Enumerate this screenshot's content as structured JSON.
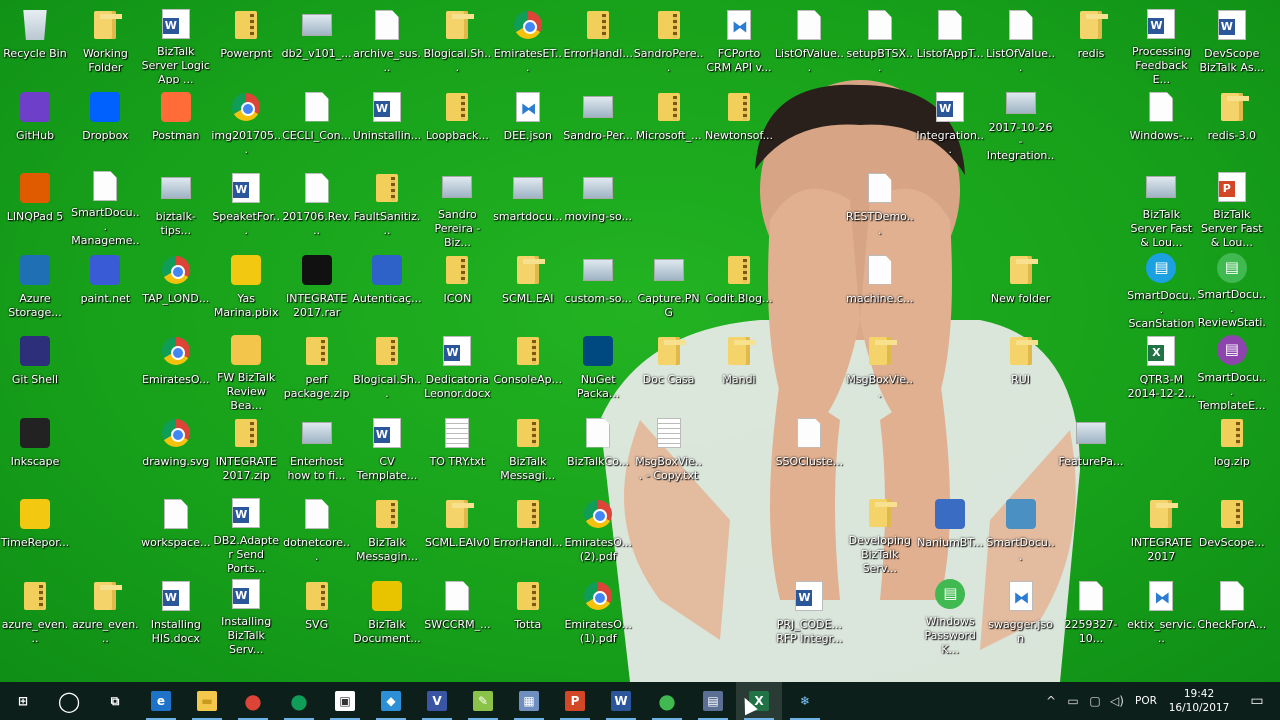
{
  "desktop": {
    "icons": [
      {
        "label": "Recycle Bin",
        "glyph": "recycle-bin-icon",
        "type": "recycle"
      },
      {
        "label": "Working Folder",
        "glyph": "folder-icon",
        "type": "folder"
      },
      {
        "label": "BizTalk Server Logic App ...",
        "glyph": "word-doc-icon",
        "type": "word"
      },
      {
        "label": "Powerpnt",
        "glyph": "powerpoint-shortcut-icon",
        "type": "zip"
      },
      {
        "label": "db2_v101_...",
        "glyph": "file-icon",
        "type": "img"
      },
      {
        "label": "archive_sus...",
        "glyph": "file-icon",
        "type": "file"
      },
      {
        "label": "Blogical.Sh...",
        "glyph": "folder-icon",
        "type": "folder"
      },
      {
        "label": "EmiratesET...",
        "glyph": "chrome-icon",
        "type": "chrome"
      },
      {
        "label": "ErrorHandl...",
        "glyph": "zip-icon",
        "type": "zip"
      },
      {
        "label": "SandroPere...",
        "glyph": "zip-icon",
        "type": "zip"
      },
      {
        "label": "FCPorto CRM API v...",
        "glyph": "vs-icon",
        "type": "vs"
      },
      {
        "label": "ListOfValue...",
        "glyph": "file-icon",
        "type": "file"
      },
      {
        "label": "setupBTSX...",
        "glyph": "file-icon",
        "type": "file"
      },
      {
        "label": "ListofAppT...",
        "glyph": "file-icon",
        "type": "file"
      },
      {
        "label": "ListOfValue...",
        "glyph": "file-icon",
        "type": "file"
      },
      {
        "label": "redis",
        "glyph": "folder-icon",
        "type": "folder"
      },
      {
        "label": "Processing Feedback E...",
        "glyph": "word-doc-icon",
        "type": "word"
      },
      {
        "label": "DevScope BizTalk As...",
        "glyph": "word-doc-icon",
        "type": "word"
      },
      {
        "label": "GitHub",
        "glyph": "github-icon",
        "type": "app",
        "color": "#6e40c9"
      },
      {
        "label": "Dropbox",
        "glyph": "dropbox-icon",
        "type": "app",
        "color": "#0061fe"
      },
      {
        "label": "Postman",
        "glyph": "postman-icon",
        "type": "app",
        "color": "#ff6c37"
      },
      {
        "label": "img201705...",
        "glyph": "chrome-icon",
        "type": "chrome"
      },
      {
        "label": "CECLI_Con...",
        "glyph": "file-icon",
        "type": "file"
      },
      {
        "label": "Uninstallin...",
        "glyph": "word-doc-icon",
        "type": "word"
      },
      {
        "label": "Loopback...",
        "glyph": "image-file-icon",
        "type": "zip"
      },
      {
        "label": "DEE.json",
        "glyph": "vs-icon",
        "type": "vs"
      },
      {
        "label": "Sandro-Per...",
        "glyph": "image-icon",
        "type": "img"
      },
      {
        "label": "Microsoft_...",
        "glyph": "zip-icon",
        "type": "zip"
      },
      {
        "label": "Newtonsof...",
        "glyph": "zip-icon",
        "type": "zip"
      },
      {
        "label": "Integration...",
        "glyph": "word-doc-icon",
        "type": "word"
      },
      {
        "label": "2017-10-26 - Integration...",
        "glyph": "image-icon",
        "type": "img"
      },
      {
        "label": "Windows-...",
        "glyph": "file-icon",
        "type": "file"
      },
      {
        "label": "redis-3.0",
        "glyph": "folder-icon",
        "type": "folder"
      },
      {
        "label": "LINQPad 5",
        "glyph": "linqpad-icon",
        "type": "app",
        "color": "#e05a00"
      },
      {
        "label": "SmartDocu... Manageme...",
        "glyph": "file-icon",
        "type": "file"
      },
      {
        "label": "biztalk-tips...",
        "glyph": "image-icon",
        "type": "img"
      },
      {
        "label": "SpeaketFor...",
        "glyph": "word-doc-icon",
        "type": "word"
      },
      {
        "label": "201706.Rev...",
        "glyph": "file-icon",
        "type": "file"
      },
      {
        "label": "FaultSanitiz...",
        "glyph": "zip-icon",
        "type": "zip"
      },
      {
        "label": "Sandro Pereira - Biz...",
        "glyph": "image-icon",
        "type": "img"
      },
      {
        "label": "smartdocu...",
        "glyph": "image-icon",
        "type": "img"
      },
      {
        "label": "moving-so...",
        "glyph": "image-icon",
        "type": "img"
      },
      {
        "label": "RESTDemo...",
        "glyph": "file-icon",
        "type": "file"
      },
      {
        "label": "BizTalk Server Fast & Lou...",
        "glyph": "image-icon",
        "type": "img"
      },
      {
        "label": "BizTalk Server Fast & Lou...",
        "glyph": "powerpoint-icon",
        "type": "ppt"
      },
      {
        "label": "Azure Storage...",
        "glyph": "azure-storage-icon",
        "type": "app",
        "color": "#1f6fb5"
      },
      {
        "label": "paint.net",
        "glyph": "paintnet-icon",
        "type": "app",
        "color": "#3a5bd6"
      },
      {
        "label": "TAP_LOND...",
        "glyph": "chrome-icon",
        "type": "chrome"
      },
      {
        "label": "Yas Marina.pbix",
        "glyph": "powerbi-icon",
        "type": "app",
        "color": "#f2c811"
      },
      {
        "label": "INTEGRATE 2017.rar",
        "glyph": "7zip-icon",
        "type": "app",
        "color": "#111111"
      },
      {
        "label": "Autenticaç...",
        "glyph": "app-icon",
        "type": "app",
        "color": "#2f62c8"
      },
      {
        "label": "ICON",
        "glyph": "image-file-icon",
        "type": "zip"
      },
      {
        "label": "SCML.EAI",
        "glyph": "folder-icon",
        "type": "folder"
      },
      {
        "label": "custom-so...",
        "glyph": "image-icon",
        "type": "img"
      },
      {
        "label": "Capture.PNG",
        "glyph": "image-icon",
        "type": "img"
      },
      {
        "label": "Codit.Blog...",
        "glyph": "zip-icon",
        "type": "zip"
      },
      {
        "label": "machine.c...",
        "glyph": "config-file-icon",
        "type": "file"
      },
      {
        "label": "New folder",
        "glyph": "folder-icon",
        "type": "folder"
      },
      {
        "label": "SmartDocu... ScanStation",
        "glyph": "smartdoc-icon",
        "type": "sdoc"
      },
      {
        "label": "SmartDocu... ReviewStati...",
        "glyph": "smartdoc-icon",
        "type": "sdoc-g"
      },
      {
        "label": "Git Shell",
        "glyph": "gitshell-icon",
        "type": "app",
        "color": "#2d2f7a"
      },
      {
        "label": "EmiratesO...",
        "glyph": "chrome-icon",
        "type": "chrome"
      },
      {
        "label": "FW BizTalk Review Bea...",
        "glyph": "email-icon",
        "type": "app",
        "color": "#f3c64b"
      },
      {
        "label": "perf package.zip",
        "glyph": "zip-icon",
        "type": "zip"
      },
      {
        "label": "Blogical.Sh...",
        "glyph": "zip-icon",
        "type": "zip"
      },
      {
        "label": "Dedicatoria Leonor.docx",
        "glyph": "word-doc-icon",
        "type": "word"
      },
      {
        "label": "ConsoleAp...",
        "glyph": "zip-icon",
        "type": "zip"
      },
      {
        "label": "NuGet Packa...",
        "glyph": "nuget-icon",
        "type": "app",
        "color": "#004880"
      },
      {
        "label": "Doc Casa",
        "glyph": "folder-icon",
        "type": "folder"
      },
      {
        "label": "Mandi",
        "glyph": "folder-icon",
        "type": "folder"
      },
      {
        "label": "MsgBoxVie...",
        "glyph": "folder-icon",
        "type": "folder"
      },
      {
        "label": "RUI",
        "glyph": "folder-icon",
        "type": "folder"
      },
      {
        "label": "QTR3-M 2014-12-2...",
        "glyph": "excel-icon",
        "type": "excel"
      },
      {
        "label": "SmartDocu... TemplateE...",
        "glyph": "smartdoc-icon",
        "type": "sdoc-p"
      },
      {
        "label": "Inkscape",
        "glyph": "inkscape-icon",
        "type": "app",
        "color": "#222222"
      },
      {
        "label": "drawing.svg",
        "glyph": "chrome-icon",
        "type": "chrome"
      },
      {
        "label": "INTEGRATE 2017.zip",
        "glyph": "zip-icon",
        "type": "zip"
      },
      {
        "label": "Enterhost how to fi...",
        "glyph": "image-icon",
        "type": "img"
      },
      {
        "label": "CV Template...",
        "glyph": "word-doc-icon",
        "type": "word"
      },
      {
        "label": "TO TRY.txt",
        "glyph": "text-file-icon",
        "type": "txt"
      },
      {
        "label": "BizTalk Messagi...",
        "glyph": "zip-icon",
        "type": "zip"
      },
      {
        "label": "BizTalkCo...",
        "glyph": "file-icon",
        "type": "file"
      },
      {
        "label": "MsgBoxVie... - Copy.txt",
        "glyph": "text-file-icon",
        "type": "txt"
      },
      {
        "label": "SSOCluste...",
        "glyph": "file-icon",
        "type": "file"
      },
      {
        "label": "FeaturePa...",
        "glyph": "image-icon",
        "type": "img"
      },
      {
        "label": "log.zip",
        "glyph": "zip-icon",
        "type": "zip"
      },
      {
        "label": "TimeRepor...",
        "glyph": "powerbi-icon",
        "type": "app",
        "color": "#f2c811"
      },
      {
        "label": "workspace...",
        "glyph": "file-icon",
        "type": "file"
      },
      {
        "label": "DB2.Adapter Send Ports...",
        "glyph": "word-doc-icon",
        "type": "word"
      },
      {
        "label": "dotnetcore...",
        "glyph": "file-icon",
        "type": "file"
      },
      {
        "label": "BizTalk Messagin...",
        "glyph": "zip-icon",
        "type": "zip"
      },
      {
        "label": "SCML.EAIv0",
        "glyph": "folder-icon",
        "type": "folder"
      },
      {
        "label": "ErrorHandl...",
        "glyph": "zip-icon",
        "type": "zip"
      },
      {
        "label": "EmiratesO... (2).pdf",
        "glyph": "chrome-icon",
        "type": "chrome"
      },
      {
        "label": "Developing BizTalk Serv...",
        "glyph": "folder-icon",
        "type": "folder"
      },
      {
        "label": "NaniumBT...",
        "glyph": "app-icon",
        "type": "app",
        "color": "#3b6cc4"
      },
      {
        "label": "SmartDocu...",
        "glyph": "app-icon",
        "type": "app",
        "color": "#4a90c2"
      },
      {
        "label": "INTEGRATE 2017",
        "glyph": "folder-icon",
        "type": "folder"
      },
      {
        "label": "DevScope...",
        "glyph": "zip-icon",
        "type": "zip"
      },
      {
        "label": "azure_even...",
        "glyph": "zip-icon",
        "type": "zip"
      },
      {
        "label": "azure_even...",
        "glyph": "folder-icon",
        "type": "folder"
      },
      {
        "label": "Installing HIS.docx",
        "glyph": "word-doc-icon",
        "type": "word"
      },
      {
        "label": "Installing BizTalk Serv...",
        "glyph": "word-doc-icon",
        "type": "word"
      },
      {
        "label": "SVG",
        "glyph": "zip-icon",
        "type": "zip"
      },
      {
        "label": "BizTalk Document...",
        "glyph": "help-icon",
        "type": "app",
        "color": "#e8c400"
      },
      {
        "label": "SWCCRM_...",
        "glyph": "file-icon",
        "type": "file"
      },
      {
        "label": "Totta",
        "glyph": "zip-icon",
        "type": "zip"
      },
      {
        "label": "EmiratesO... (1).pdf",
        "glyph": "chrome-icon",
        "type": "chrome"
      },
      {
        "label": "PRJ_CODE... RFP Integr...",
        "glyph": "word-doc-icon",
        "type": "word"
      },
      {
        "label": "Windows Password K...",
        "glyph": "app-icon",
        "type": "sdoc-g"
      },
      {
        "label": "swagger.json",
        "glyph": "vs-icon",
        "type": "vs"
      },
      {
        "label": "2259327-10...",
        "glyph": "file-icon",
        "type": "file"
      },
      {
        "label": "ektix_servic...",
        "glyph": "vs-icon",
        "type": "vs"
      },
      {
        "label": "CheckForA...",
        "glyph": "file-icon",
        "type": "file"
      }
    ]
  },
  "taskbar": {
    "apps": [
      {
        "name": "start-button",
        "icon": "windows-logo-icon",
        "glyph": "⊞",
        "bg": "transparent",
        "color": "#ffffff"
      },
      {
        "name": "cortana-button",
        "icon": "cortana-icon",
        "glyph": "◯",
        "bg": "transparent",
        "color": "#ffffff"
      },
      {
        "name": "task-view-button",
        "icon": "task-view-icon",
        "glyph": "⧉",
        "bg": "transparent",
        "color": "#ffffff"
      },
      {
        "name": "taskbar-edge",
        "icon": "edge-icon",
        "glyph": "e",
        "bg": "#1e73c9",
        "color": "#ffffff"
      },
      {
        "name": "taskbar-file-explorer",
        "icon": "folder-icon",
        "glyph": "▬",
        "bg": "#f4c84a",
        "color": "#c89a20"
      },
      {
        "name": "taskbar-chrome",
        "icon": "chrome-icon",
        "glyph": "●",
        "bg": "transparent",
        "color": "#db4437"
      },
      {
        "name": "taskbar-chrome-2",
        "icon": "chrome-icon",
        "glyph": "●",
        "bg": "transparent",
        "color": "#0f9d58"
      },
      {
        "name": "taskbar-store",
        "icon": "store-icon",
        "glyph": "▣",
        "bg": "#ffffff",
        "color": "#333333"
      },
      {
        "name": "taskbar-app-blue",
        "icon": "app-icon",
        "glyph": "◆",
        "bg": "#2d8fd5",
        "color": "#ffffff"
      },
      {
        "name": "taskbar-visio",
        "icon": "visio-icon",
        "glyph": "V",
        "bg": "#3955a3",
        "color": "#ffffff"
      },
      {
        "name": "taskbar-notepad",
        "icon": "notepad-icon",
        "glyph": "✎",
        "bg": "#8bc34a",
        "color": "#ffffff"
      },
      {
        "name": "taskbar-biztalk-admin",
        "icon": "biztalk-icon",
        "glyph": "▦",
        "bg": "#6e8fbf",
        "color": "#ffffff"
      },
      {
        "name": "taskbar-powerpoint",
        "icon": "powerpoint-icon",
        "glyph": "P",
        "bg": "#d24726",
        "color": "#ffffff"
      },
      {
        "name": "taskbar-word",
        "icon": "word-icon",
        "glyph": "W",
        "bg": "#2b579a",
        "color": "#ffffff"
      },
      {
        "name": "taskbar-green-app",
        "icon": "app-icon",
        "glyph": "●",
        "bg": "transparent",
        "color": "#3fb950"
      },
      {
        "name": "taskbar-sql",
        "icon": "sql-icon",
        "glyph": "▤",
        "bg": "#5b6f95",
        "color": "#ffffff"
      },
      {
        "name": "taskbar-excel",
        "icon": "excel-icon",
        "glyph": "X",
        "bg": "#217346",
        "color": "#ffffff"
      },
      {
        "name": "taskbar-snowflake-app",
        "icon": "snowflake-icon",
        "glyph": "❄",
        "bg": "transparent",
        "color": "#7fc7ff"
      }
    ],
    "tray": {
      "chevron": "^",
      "language": "POR",
      "time": "19:42",
      "date": "16/10/2017",
      "notification_icon": "▭"
    }
  }
}
